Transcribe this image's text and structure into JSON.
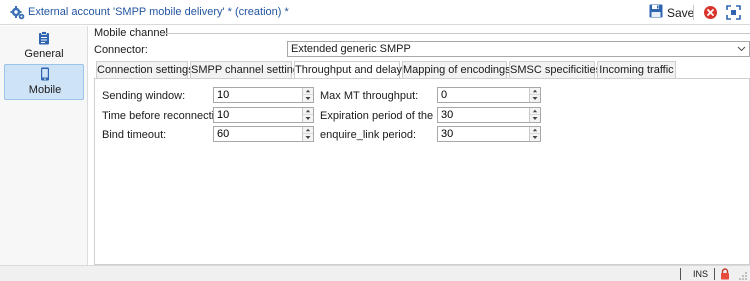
{
  "window": {
    "title": "External account 'SMPP mobile delivery' * (creation) *",
    "save_label": "Save"
  },
  "sidebar": {
    "items": [
      {
        "label": "General",
        "icon": "clipboard-icon"
      },
      {
        "label": "Mobile",
        "icon": "mobile-phone-icon",
        "selected": true
      }
    ]
  },
  "main": {
    "section_title": "Mobile channel",
    "connector_label": "Connector:",
    "connector_value": "Extended generic SMPP",
    "tabs": [
      {
        "label": "Connection settings"
      },
      {
        "label": "SMPP channel settings"
      },
      {
        "label": "Throughput and delays",
        "active": true
      },
      {
        "label": "Mapping of encodings"
      },
      {
        "label": "SMSC specificities"
      },
      {
        "label": "Incoming traffic"
      }
    ],
    "fields": {
      "sending_window": {
        "label": "Sending window:",
        "value": "10"
      },
      "time_before_reconnection": {
        "label": "Time before reconnection:",
        "value": "10"
      },
      "bind_timeout": {
        "label": "Bind timeout:",
        "value": "60"
      },
      "max_mt_throughput": {
        "label": "Max MT throughput:",
        "value": "0"
      },
      "expiration_period_mt": {
        "label": "Expiration period of the MT:",
        "value": "30"
      },
      "enquire_link_period": {
        "label": "enquire_link period:",
        "value": "30"
      }
    }
  },
  "statusbar": {
    "mode": "INS"
  },
  "colors": {
    "accent": "#2355a0",
    "selected_bg": "#cfe3f7",
    "close_red": "#d9342b"
  }
}
